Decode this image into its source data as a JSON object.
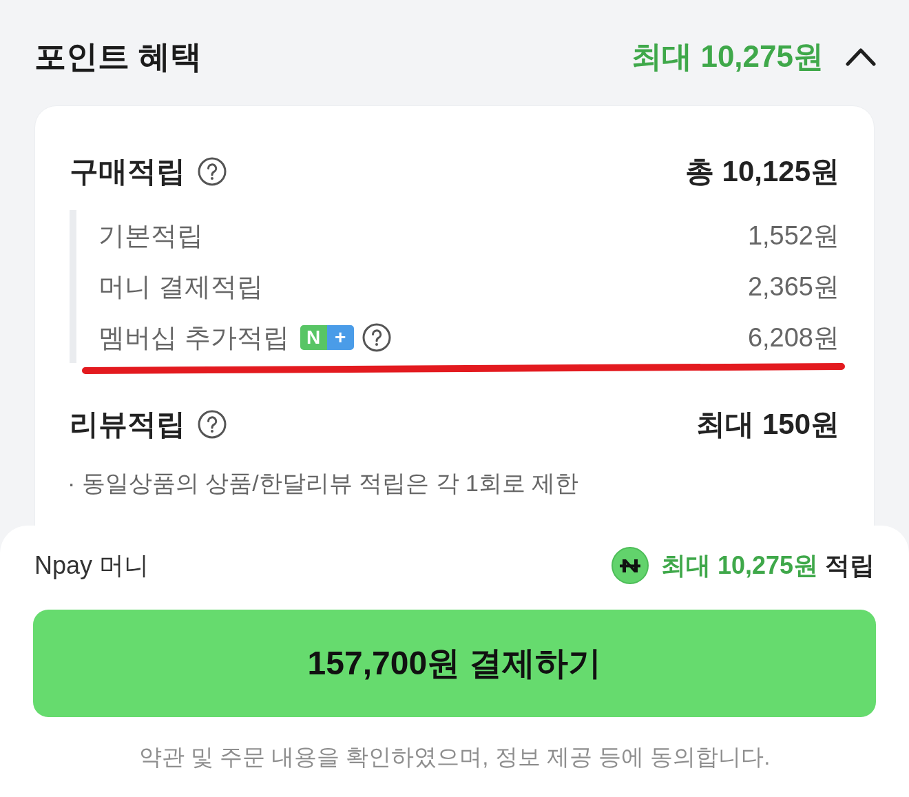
{
  "header": {
    "title": "포인트 혜택",
    "max_label": "최대 10,275원",
    "expanded": true
  },
  "sections": [
    {
      "title": "구매적립",
      "help": true,
      "total": "총 10,125원",
      "items": [
        {
          "label": "기본적립",
          "amount": "1,552원"
        },
        {
          "label": "머니 결제적립",
          "amount": "2,365원"
        },
        {
          "label": "멤버십 추가적립",
          "badge": [
            {
              "text": "N",
              "color": "#58c565"
            },
            {
              "text": "+",
              "color": "#4a9ce8"
            }
          ],
          "help": true,
          "amount": "6,208원"
        }
      ],
      "annotation": {
        "kind": "underline"
      }
    },
    {
      "title": "리뷰적립",
      "help": true,
      "total": "최대 150원",
      "note": "· 동일상품의 상품/한달리뷰 적립은 각 1회로 제한"
    }
  ],
  "payment_bar": {
    "method": "Npay 머니",
    "reward_amount": "최대 10,275원",
    "reward_suffix": "적립",
    "pay_button": "157,700원 결제하기",
    "consent": "약관 및 주문 내용을 확인하였으며, 정보 제공 등에 동의합니다."
  }
}
